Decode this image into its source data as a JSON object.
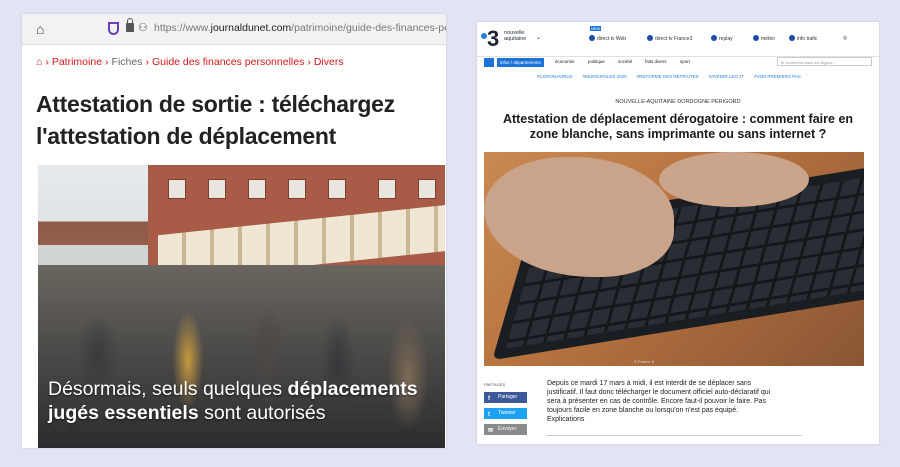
{
  "left": {
    "url_prefix": "https://www.",
    "url_domain": "journaldunet.com",
    "url_path": "/patrimoine/guide-des-finances-personnel",
    "breadcrumb": [
      "Patrimoine",
      "Fiches",
      "Guide des finances personnelles",
      "Divers"
    ],
    "title": "Attestation de sortie : téléchargez l'attestation de déplacement",
    "caption_parts": [
      "Désormais, seuls quelques ",
      "déplacements jugés essentiels",
      " sont autorisés"
    ]
  },
  "right": {
    "logo_number": "3",
    "logo_text_1": "nouvelle",
    "logo_text_2": "aquitaine",
    "topbar": [
      "direct tv Web",
      "direct tv France3",
      "replay",
      "météo",
      "info trafic"
    ],
    "region_tab": "infos / départements",
    "nav": [
      "économie",
      "politique",
      "société",
      "faits divers",
      "sport"
    ],
    "search_placeholder": "Je recherche dans ma région...",
    "tags": [
      "#CORONAVIRUS",
      "#MUNICIPALES 2020",
      "#REFORME DES RETRAITES",
      "#AVENIR LEO JT",
      "#VOS PREMIERS PAS"
    ],
    "kicker": "NOUVELLE-AQUITAINE  DORDOGNE  PÉRIGORD",
    "title": "Attestation de déplacement dérogatoire : comment faire en zone blanche, sans imprimante ou sans internet ?",
    "photo_credit": "© France 3",
    "share_label": "PARTAGES",
    "share_buttons": [
      "Partager",
      "Tweeter",
      "Envoyer"
    ],
    "body": "Depuis ce mardi 17 mars à midi, il est interdit de se déplacer sans justificatif. Il faut donc télécharger le document officiel auto-déclaratif qui sera à présenter en cas de contrôle. Encore faut-il pouvoir le faire. Pas toujours facile en zone blanche ou lorsqu'on n'est pas équipé. Explications"
  },
  "colors": {
    "background": "#e3e4f3",
    "jdn_red": "#d3161b",
    "france3_blue": "#1c73d9",
    "facebook": "#3b5998",
    "twitter": "#1da1f2",
    "email": "#8a8a8a"
  }
}
